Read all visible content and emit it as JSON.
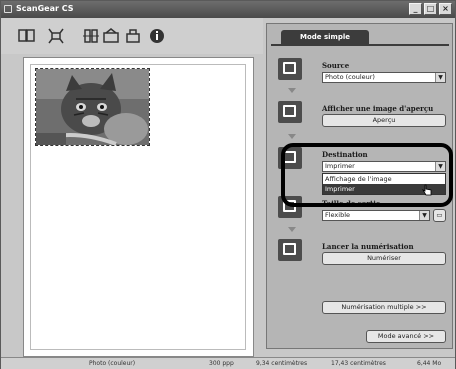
{
  "window": {
    "title": "ScanGear CS"
  },
  "panel": {
    "tab_label": "Mode simple",
    "source": {
      "label": "Source",
      "value": "Photo (couleur)"
    },
    "preview": {
      "label": "Afficher une image d'aperçu",
      "button": "Aperçu"
    },
    "destination": {
      "label": "Destination",
      "value": "Imprimer",
      "options": [
        "Affichage de l'image",
        "Imprimer"
      ],
      "selected_index": 1
    },
    "output_size": {
      "label": "Taille de sortie",
      "value": "Flexible"
    },
    "scan": {
      "label": "Lancer la numérisation",
      "button": "Numériser"
    },
    "multi_scan_button": "Numérisation multiple >>",
    "advanced_button": "Mode avancé >>"
  },
  "status": {
    "mode": "Photo (couleur)",
    "resolution": "300 ppp",
    "width": "9,34 centimètres",
    "height": "17,43 centimètres",
    "filesize": "6,44 Mo"
  }
}
